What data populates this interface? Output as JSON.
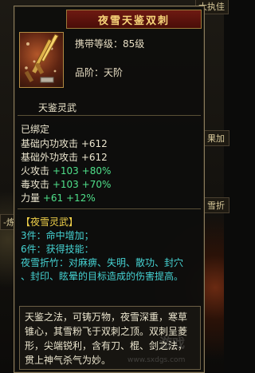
{
  "background": {
    "top_right_text": "大执佳",
    "right_mid_text": "果加",
    "right_lower_text": "雪折",
    "left_text": "-炼",
    "watermark": "游戏",
    "watermark_url": "www.sxdgs.com"
  },
  "tooltip": {
    "title": "夜雪天鉴双刺",
    "icon": "dual-dagger-icon",
    "level_label": "携带等级：85级",
    "grade_label": "品阶：天阶",
    "item_name": "天鉴灵武",
    "bound": "已绑定",
    "stats": [
      {
        "label": "基础内功攻击",
        "value": "+612",
        "bonus": ""
      },
      {
        "label": "基础外功攻击",
        "value": "+612",
        "bonus": ""
      },
      {
        "label": "火攻击",
        "value": "+103",
        "bonus": "+80%"
      },
      {
        "label": "毒攻击",
        "value": "+103",
        "bonus": "+70%"
      },
      {
        "label": "力量",
        "value": "+61",
        "bonus": "+12%"
      }
    ],
    "set": {
      "name": "【夜雪灵武】",
      "piece3": "3件：命中增加；",
      "piece6": "6件：获得技能：",
      "skill_line1": "夜雪折竹：对麻痹、失明、散功、封穴",
      "skill_line2": "、封印、眩晕的目标造成的伤害提高。"
    },
    "description": "天鉴之法，可铸万物，夜雪深重，寒草锥心，其雪粉飞于双刺之顶。双刺呈菱形，尖端锐利，含有刀、棍、剑之法，贯上神气杀气为妙。"
  },
  "colors": {
    "title_bg": "#6e1a12",
    "title_text": "#f7d479",
    "stat_green": "#4fe08a",
    "set_cyan": "#45d2d2",
    "set_name_yellow": "#f2d24a"
  }
}
